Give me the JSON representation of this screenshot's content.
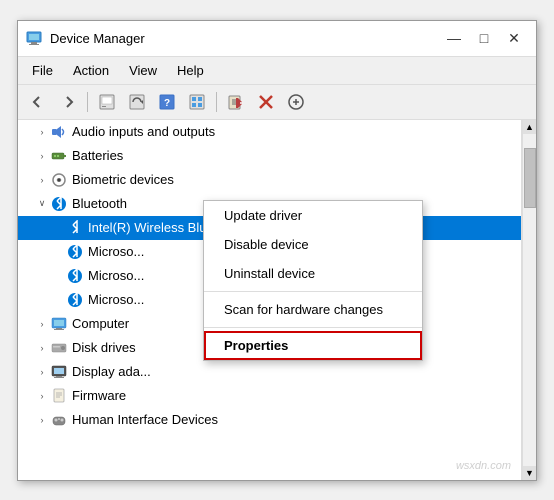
{
  "window": {
    "title": "Device Manager",
    "icon_char": "🖥",
    "controls": {
      "minimize": "—",
      "maximize": "□",
      "close": "✕"
    }
  },
  "menubar": {
    "items": [
      "File",
      "Action",
      "View",
      "Help"
    ]
  },
  "toolbar": {
    "buttons": [
      "←",
      "→",
      "⊞",
      "⊟",
      "?",
      "⊡",
      "🖥",
      "🖨",
      "❌",
      "⊕"
    ]
  },
  "tree": {
    "items": [
      {
        "id": "audio",
        "label": "Audio inputs and outputs",
        "indent": 1,
        "expand": ">",
        "icon": "🔊"
      },
      {
        "id": "batteries",
        "label": "Batteries",
        "indent": 1,
        "expand": ">",
        "icon": "🔋"
      },
      {
        "id": "biometric",
        "label": "Biometric devices",
        "indent": 1,
        "expand": ">",
        "icon": "👁"
      },
      {
        "id": "bluetooth",
        "label": "Bluetooth",
        "indent": 1,
        "expand": "∨",
        "icon": "🔵",
        "expanded": true
      },
      {
        "id": "intel-bt",
        "label": "Intel(R) Wireless Bluetooth(R)",
        "indent": 2,
        "expand": "",
        "icon": "🔵",
        "selected": true
      },
      {
        "id": "microsoft1",
        "label": "Microso...",
        "indent": 2,
        "expand": "",
        "icon": "🔵"
      },
      {
        "id": "microsoft2",
        "label": "Microso...",
        "indent": 2,
        "expand": "",
        "icon": "🔵"
      },
      {
        "id": "microsoft3",
        "label": "Microso...",
        "indent": 2,
        "expand": "",
        "icon": "🔵"
      },
      {
        "id": "computer",
        "label": "Computer",
        "indent": 1,
        "expand": ">",
        "icon": "💻"
      },
      {
        "id": "disk",
        "label": "Disk drives",
        "indent": 1,
        "expand": ">",
        "icon": "💾"
      },
      {
        "id": "display",
        "label": "Display ada...",
        "indent": 1,
        "expand": ">",
        "icon": "🖥"
      },
      {
        "id": "firmware",
        "label": "Firmware",
        "indent": 1,
        "expand": ">",
        "icon": "📄"
      },
      {
        "id": "hid",
        "label": "Human Interface Devices",
        "indent": 1,
        "expand": ">",
        "icon": "🎮"
      }
    ]
  },
  "context_menu": {
    "items": [
      {
        "id": "update-driver",
        "label": "Update driver"
      },
      {
        "id": "disable-device",
        "label": "Disable device"
      },
      {
        "id": "uninstall-device",
        "label": "Uninstall device"
      },
      {
        "id": "sep1",
        "type": "sep"
      },
      {
        "id": "scan-hardware",
        "label": "Scan for hardware changes"
      },
      {
        "id": "sep2",
        "type": "sep"
      },
      {
        "id": "properties",
        "label": "Properties",
        "bold": true
      }
    ]
  },
  "watermark": "wsxdn.com"
}
